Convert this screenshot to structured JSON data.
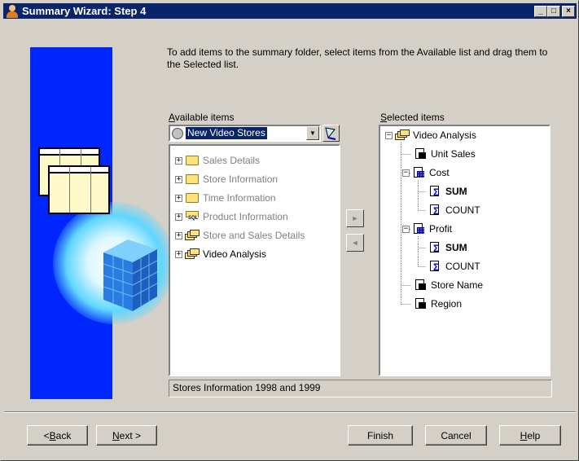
{
  "window": {
    "title": "Summary Wizard: Step 4",
    "controls": {
      "minimize": "_",
      "maximize": "□",
      "close": "×"
    }
  },
  "instructions": "To add items to the summary folder, select items from the Available list and drag them to the Selected list.",
  "available": {
    "label_prefix": "",
    "label_access": "A",
    "label_rest": "vailable items",
    "combo_value": "New Video Stores",
    "items": [
      {
        "label": "Sales Details",
        "icon": "folder-icon",
        "enabled": false
      },
      {
        "label": "Store Information",
        "icon": "folder-icon",
        "enabled": false
      },
      {
        "label": "Time Information",
        "icon": "folder-icon",
        "enabled": false
      },
      {
        "label": "Product Information",
        "icon": "sql-folder-icon",
        "enabled": false
      },
      {
        "label": "Store and Sales Details",
        "icon": "folder-stack-icon",
        "enabled": false
      },
      {
        "label": "Video Analysis",
        "icon": "folder-stack-icon",
        "enabled": true
      }
    ]
  },
  "selected": {
    "label_access": "S",
    "label_rest": "elected items",
    "root": "Video Analysis",
    "items": [
      {
        "label": "Unit Sales"
      },
      {
        "label": "Cost"
      },
      {
        "label": "SUM"
      },
      {
        "label": "COUNT"
      },
      {
        "label": "Profit"
      },
      {
        "label": "SUM"
      },
      {
        "label": "COUNT"
      },
      {
        "label": "Store Name"
      },
      {
        "label": "Region"
      }
    ]
  },
  "move_buttons": {
    "add": "►",
    "remove": "◄"
  },
  "description": "Stores Information 1998 and 1999",
  "buttons": {
    "back_prefix": "< ",
    "back_access": "B",
    "back_rest": "ack",
    "next_access": "N",
    "next_rest": "ext >",
    "finish": "Finish",
    "cancel": "Cancel",
    "help_access": "H",
    "help_rest": "elp"
  },
  "colors": {
    "titlebar": "#0a246a",
    "banner": "#0026ff",
    "face": "#d4d0c8"
  }
}
